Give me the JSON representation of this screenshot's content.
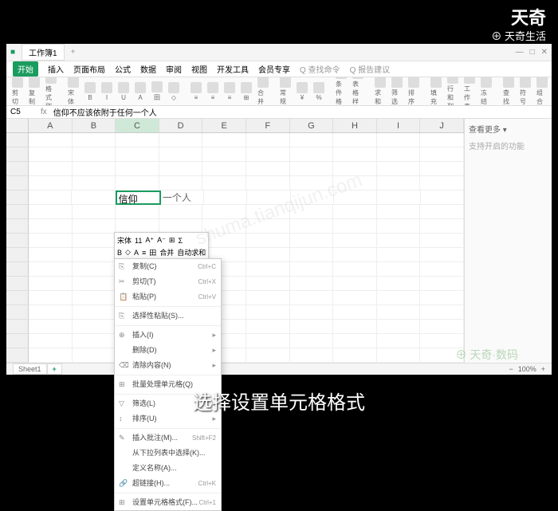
{
  "watermark": {
    "top": "天奇",
    "sub": "⊕ 天奇生活",
    "center": "shuma.tianqijun.com",
    "br": "⊕ 天奇·数码"
  },
  "caption": "选择设置单元格格式",
  "titlebar": {
    "icon": "■",
    "doc": "工作簿1",
    "plus": "+"
  },
  "menu": {
    "file": "开始",
    "items": [
      "插入",
      "页面布局",
      "公式",
      "数据",
      "审阅",
      "视图",
      "开发工具",
      "会员专享",
      "Q 查找命令",
      "Q 报告建议"
    ]
  },
  "ribbon": [
    "剪切",
    "复制",
    "格式刷",
    "|",
    "宋体",
    "B",
    "I",
    "U",
    "A",
    "田",
    "◇",
    "|",
    "≡",
    "≡",
    "≡",
    "⊞",
    "合并",
    "|",
    "常规",
    "¥",
    "%",
    "|",
    "条件格式",
    "表格样式",
    "|",
    "求和",
    "筛选",
    "排序",
    "|",
    "填充",
    "行和列",
    "工作表",
    "冻结",
    "|",
    "查找",
    "符号",
    "组合"
  ],
  "formula": {
    "ref": "C5",
    "fx": "fx",
    "text": "信仰不应该依附于任何一个人"
  },
  "cols": [
    "A",
    "B",
    "C",
    "D",
    "E",
    "F",
    "G",
    "H",
    "I",
    "J"
  ],
  "cellval": "信仰",
  "minitoolbar": {
    "font": "宋体",
    "size": "11",
    "row1": [
      "A⁺",
      "A⁻",
      "⊞",
      "Σ"
    ],
    "row2": [
      "B",
      "◇",
      "A",
      "≡",
      "田",
      "合并",
      "自动求和"
    ]
  },
  "ctx": [
    {
      "t": "复制(C)",
      "sc": "Ctrl+C",
      "i": "⎘"
    },
    {
      "t": "剪切(T)",
      "sc": "Ctrl+X",
      "i": "✂"
    },
    {
      "t": "粘贴(P)",
      "sc": "Ctrl+V",
      "i": "📋"
    },
    {
      "sep": true
    },
    {
      "t": "选择性粘贴(S)...",
      "i": "⎘"
    },
    {
      "sep": true
    },
    {
      "t": "插入(I)",
      "arr": "▸",
      "i": "⊕"
    },
    {
      "t": "删除(D)",
      "arr": "▸"
    },
    {
      "t": "清除内容(N)",
      "arr": "▸",
      "i": "⌫"
    },
    {
      "sep": true
    },
    {
      "t": "批量处理单元格(Q)",
      "i": "⊞"
    },
    {
      "sep": true
    },
    {
      "t": "筛选(L)",
      "arr": "▸",
      "i": "▽"
    },
    {
      "t": "排序(U)",
      "arr": "▸",
      "i": "↕"
    },
    {
      "sep": true
    },
    {
      "t": "插入批注(M)...",
      "sc": "Shift+F2",
      "i": "✎"
    },
    {
      "t": "从下拉列表中选择(K)..."
    },
    {
      "t": "定义名称(A)..."
    },
    {
      "t": "超链接(H)...",
      "sc": "Ctrl+K",
      "i": "🔗"
    },
    {
      "sep": true
    },
    {
      "t": "设置单元格格式(F)...",
      "sc": "Ctrl+1",
      "i": "⊞"
    }
  ],
  "sidepanel": {
    "title": "查看更多 ▾",
    "sub": "支持开启的功能"
  },
  "status": {
    "sheet": "Sheet1",
    "plus": "+",
    "zoom": "100%"
  }
}
